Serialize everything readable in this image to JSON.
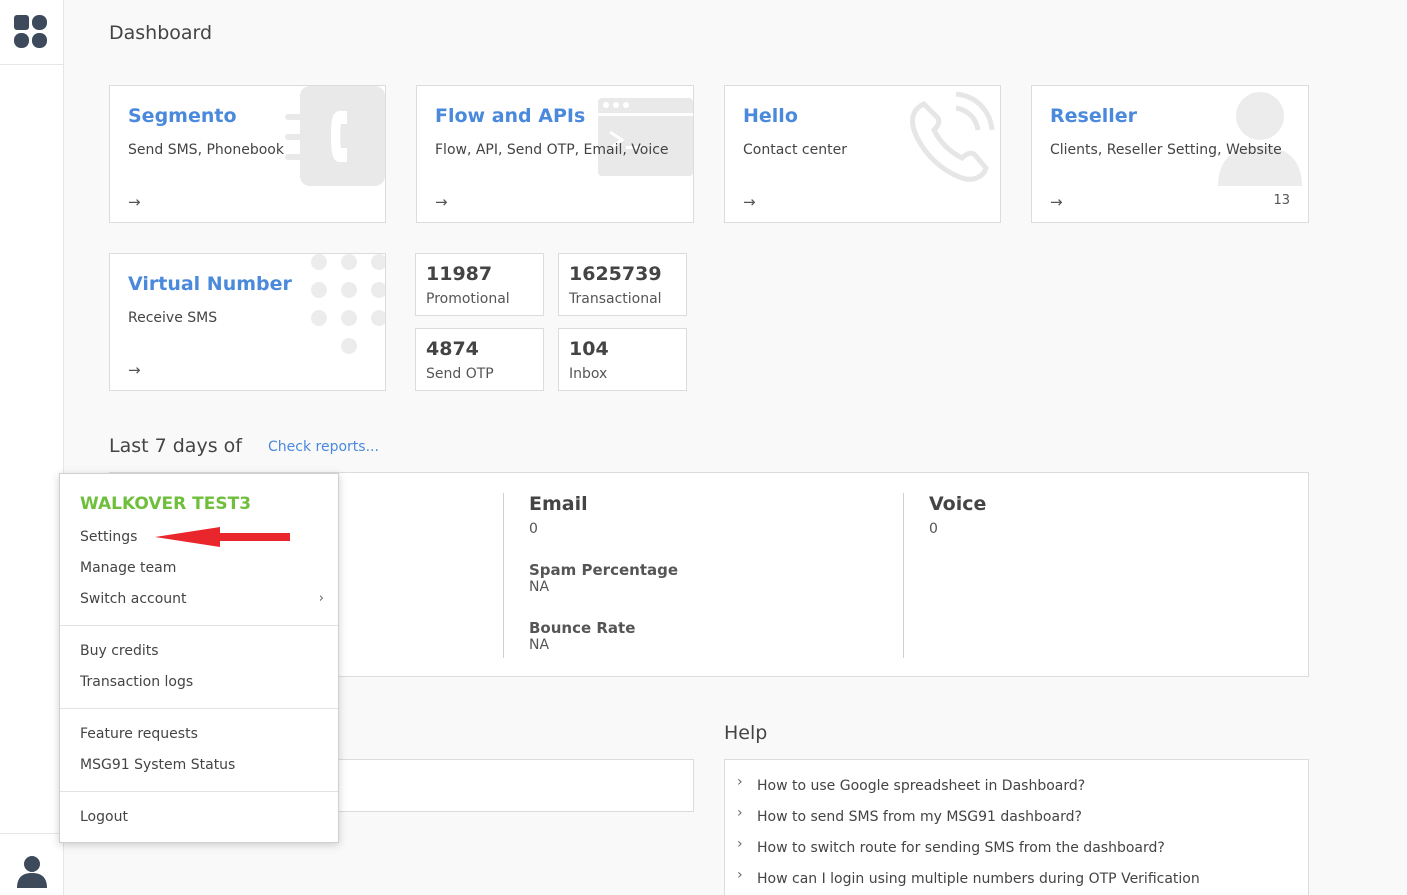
{
  "page": {
    "title": "Dashboard"
  },
  "cards": [
    {
      "title": "Segmento",
      "subtitle": "Send SMS, Phonebook",
      "arrow": "→"
    },
    {
      "title": "Flow and APIs",
      "subtitle": "Flow, API, Send OTP, Email, Voice",
      "arrow": "→"
    },
    {
      "title": "Hello",
      "subtitle": "Contact center",
      "arrow": "→"
    },
    {
      "title": "Reseller",
      "subtitle": "Clients, Reseller Setting, Website",
      "arrow": "→",
      "count": "13"
    },
    {
      "title": "Virtual Number",
      "subtitle": "Receive SMS",
      "arrow": "→"
    }
  ],
  "stats": [
    {
      "value": "11987",
      "label": "Promotional"
    },
    {
      "value": "1625739",
      "label": "Transactional"
    },
    {
      "value": "4874",
      "label": "Send OTP"
    },
    {
      "value": "104",
      "label": "Inbox"
    }
  ],
  "report": {
    "section_title": "Last 7 days of",
    "check_link": "Check reports...",
    "email": {
      "heading": "Email",
      "value": "0",
      "spam_label": "Spam Percentage",
      "spam_value": "NA",
      "bounce_label": "Bounce Rate",
      "bounce_value": "NA"
    },
    "voice": {
      "heading": "Voice",
      "value": "0"
    }
  },
  "help": {
    "title": "Help",
    "items": [
      "How to use Google spreadsheet in Dashboard?",
      "How to send SMS from my MSG91 dashboard?",
      "How to switch route for sending SMS from the dashboard?",
      "How can I login using multiple numbers during OTP Verification"
    ]
  },
  "dropdown": {
    "account_name": "WALKOVER TEST3",
    "settings": "Settings",
    "manage_team": "Manage team",
    "switch_account": "Switch account",
    "switch_chevron": "›",
    "buy_credits": "Buy credits",
    "transaction_logs": "Transaction logs",
    "feature_requests": "Feature requests",
    "system_status": "MSG91 System Status",
    "logout": "Logout"
  },
  "colors": {
    "accent_blue": "#4a89dc",
    "account_green": "#6fbf3d",
    "annotation_red": "#e8262b",
    "icon_dark": "#3d4a5c"
  },
  "icons": [
    "apps-grid-icon",
    "user-avatar-icon",
    "phone-icon",
    "terminal-window-icon",
    "phone-call-icon",
    "person-icon",
    "dot-grid-icon",
    "arrow-right-icon",
    "chevron-right-icon"
  ]
}
